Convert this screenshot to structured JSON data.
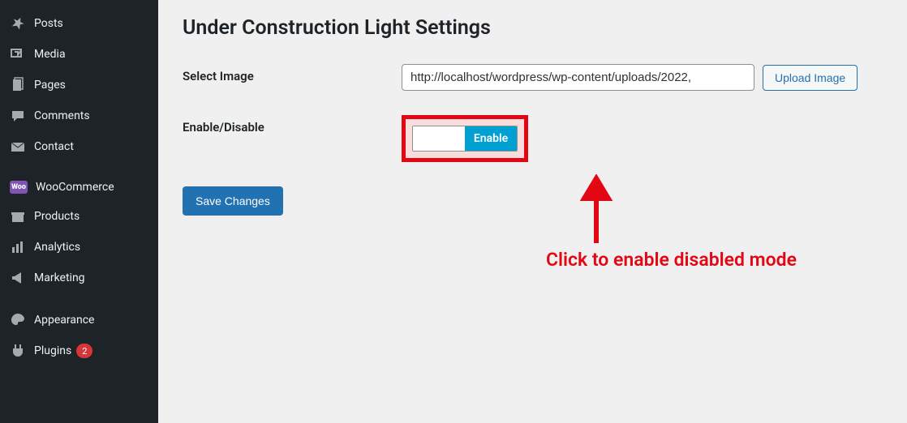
{
  "sidebar": {
    "items": [
      {
        "label": "Posts",
        "icon": "pin"
      },
      {
        "label": "Media",
        "icon": "media"
      },
      {
        "label": "Pages",
        "icon": "pages"
      },
      {
        "label": "Comments",
        "icon": "comments"
      },
      {
        "label": "Contact",
        "icon": "contact"
      },
      {
        "label": "WooCommerce",
        "icon": "woo"
      },
      {
        "label": "Products",
        "icon": "products"
      },
      {
        "label": "Analytics",
        "icon": "analytics"
      },
      {
        "label": "Marketing",
        "icon": "marketing"
      },
      {
        "label": "Appearance",
        "icon": "appearance"
      },
      {
        "label": "Plugins",
        "icon": "plugins",
        "badge": "2"
      }
    ]
  },
  "page": {
    "title": "Under Construction Light Settings"
  },
  "form": {
    "select_image_label": "Select Image",
    "image_value": "http://localhost/wordpress/wp-content/uploads/2022,",
    "upload_label": "Upload Image",
    "enable_label": "Enable/Disable",
    "toggle_on": "Enable",
    "save_label": "Save Changes"
  },
  "annotation": {
    "text": "Click to enable disabled mode"
  }
}
